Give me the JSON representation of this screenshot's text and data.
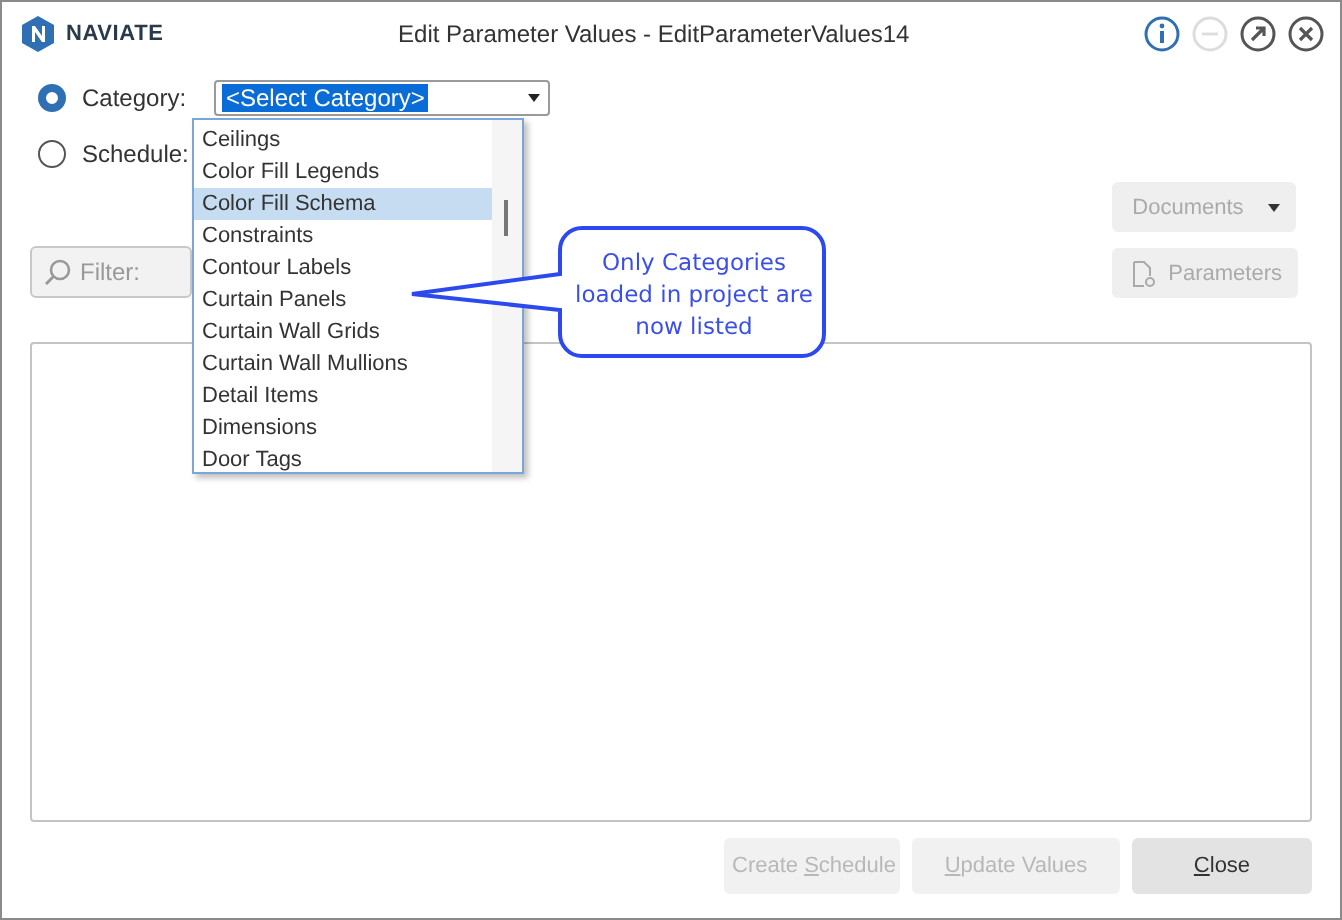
{
  "window": {
    "logo": "NAVIATE",
    "title": "Edit Parameter Values - EditParameterValues14"
  },
  "source_options": [
    {
      "label": "Category:",
      "selected": true
    },
    {
      "label": "Schedule:",
      "selected": false
    }
  ],
  "category_combo": {
    "value": "<Select Category>",
    "items": [
      {
        "label": "Ceilings",
        "selected": false
      },
      {
        "label": "Color Fill Legends",
        "selected": false
      },
      {
        "label": "Color Fill Schema",
        "selected": true
      },
      {
        "label": "Constraints",
        "selected": false
      },
      {
        "label": "Contour Labels",
        "selected": false
      },
      {
        "label": "Curtain Panels",
        "selected": false
      },
      {
        "label": "Curtain Wall Grids",
        "selected": false
      },
      {
        "label": "Curtain Wall Mullions",
        "selected": false
      },
      {
        "label": "Detail Items",
        "selected": false
      },
      {
        "label": "Dimensions",
        "selected": false
      },
      {
        "label": "Door Tags",
        "selected": false
      }
    ]
  },
  "filter": {
    "placeholder": "Filter:"
  },
  "side_buttons": [
    {
      "kind": "dropdown",
      "label": "Documents",
      "disabled": true
    },
    {
      "kind": "icon",
      "label": "Parameters",
      "disabled": true
    }
  ],
  "callout": {
    "text": "Only Categories loaded in project are now listed"
  },
  "footer_buttons": [
    {
      "before": "Create ",
      "key": "S",
      "after": "chedule",
      "disabled": true
    },
    {
      "key": "U",
      "after": "pdate Values",
      "disabled": true
    },
    {
      "key": "C",
      "after": "lose",
      "disabled": false
    }
  ]
}
